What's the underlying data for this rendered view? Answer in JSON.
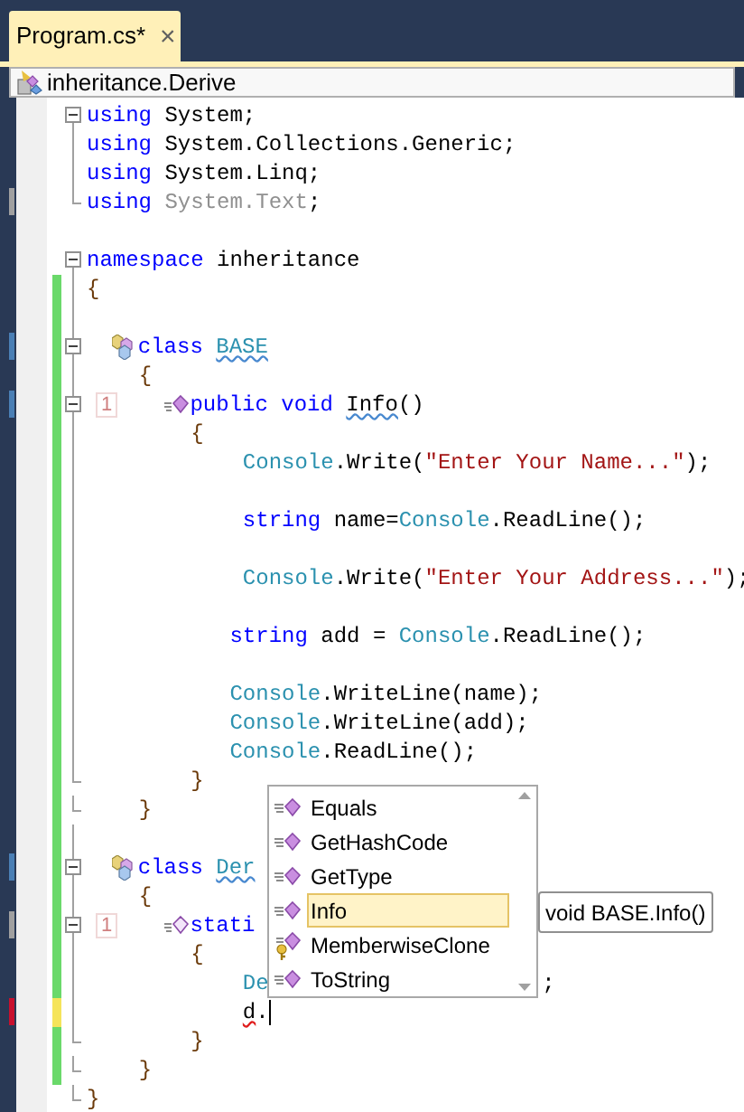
{
  "tab": {
    "title": "Program.cs*",
    "close": "×",
    "selected": true
  },
  "navigation": {
    "type": "inheritance.Derive"
  },
  "lines": [
    {
      "kind": "code",
      "expanded": true,
      "tokens": [
        {
          "kind": "keyword",
          "s": "using"
        },
        {
          "kind": "plain",
          "s": " System;"
        }
      ]
    },
    {
      "kind": "code",
      "tokens": [
        {
          "kind": "keyword",
          "s": "using"
        },
        {
          "kind": "plain",
          "s": " System.Collections.Generic;"
        }
      ]
    },
    {
      "kind": "code",
      "tokens": [
        {
          "kind": "keyword",
          "s": "using"
        },
        {
          "kind": "plain",
          "s": " System.Linq;"
        }
      ]
    },
    {
      "kind": "code",
      "region_end": true,
      "color": "#a0a0a0",
      "tokens": [
        {
          "kind": "keyword",
          "s": "using"
        },
        {
          "kind": "faded",
          "s": " System.Text"
        },
        {
          "kind": "plain",
          "s": ";"
        }
      ]
    },
    {
      "kind": "code"
    },
    {
      "kind": "code",
      "expanded": true,
      "tokens": [
        {
          "kind": "keyword",
          "s": "namespace"
        },
        {
          "kind": "plain",
          "s": " inheritance"
        }
      ]
    },
    {
      "kind": "code",
      "modified": true,
      "saved": true,
      "tokens": [
        {
          "kind": "brace",
          "s": "{"
        }
      ]
    },
    {
      "kind": "code",
      "modified": true,
      "saved": true
    },
    {
      "kind": "class",
      "expanded": true,
      "modified": true,
      "saved": true,
      "color": "#4a7fb5",
      "tokens": [
        {
          "kind": "keyword",
          "s": "  class"
        },
        {
          "kind": "type",
          "s": " BASE",
          "warning": true
        }
      ]
    },
    {
      "kind": "code",
      "modified": true,
      "saved": true,
      "tokens": [
        {
          "kind": "brace",
          "s": "    {"
        }
      ]
    },
    {
      "kind": "method",
      "expanded": true,
      "modified": true,
      "saved": true,
      "color": "#4a7fb5",
      "refs": "1",
      "tokens": [
        {
          "kind": "keyword",
          "s": "      public"
        },
        {
          "kind": "keyword",
          "s": " void"
        },
        {
          "kind": "plain",
          "s": " Info",
          "warning": true
        },
        {
          "kind": "plain",
          "s": "()"
        }
      ]
    },
    {
      "kind": "code",
      "modified": true,
      "saved": true,
      "tokens": [
        {
          "kind": "brace",
          "s": "        {"
        }
      ]
    },
    {
      "kind": "code",
      "modified": true,
      "saved": true,
      "tokens": [
        {
          "kind": "type",
          "s": "            Console"
        },
        {
          "kind": "plain",
          "s": ".Write("
        },
        {
          "kind": "string",
          "s": "\"Enter Your Name...\""
        },
        {
          "kind": "plain",
          "s": ");"
        }
      ]
    },
    {
      "kind": "code",
      "modified": true,
      "saved": true
    },
    {
      "kind": "code",
      "modified": true,
      "saved": true,
      "tokens": [
        {
          "kind": "keyword",
          "s": "            string"
        },
        {
          "kind": "plain",
          "s": " name="
        },
        {
          "kind": "type",
          "s": "Console"
        },
        {
          "kind": "plain",
          "s": ".ReadLine();"
        }
      ]
    },
    {
      "kind": "code",
      "modified": true,
      "saved": true
    },
    {
      "kind": "code",
      "modified": true,
      "saved": true,
      "tokens": [
        {
          "kind": "type",
          "s": "            Console"
        },
        {
          "kind": "plain",
          "s": ".Write("
        },
        {
          "kind": "string",
          "s": "\"Enter Your Address...\""
        },
        {
          "kind": "plain",
          "s": ");"
        }
      ]
    },
    {
      "kind": "code",
      "modified": true,
      "saved": true
    },
    {
      "kind": "code",
      "modified": true,
      "saved": true,
      "tokens": [
        {
          "kind": "keyword",
          "s": "           string"
        },
        {
          "kind": "plain",
          "s": " add = "
        },
        {
          "kind": "type",
          "s": "Console"
        },
        {
          "kind": "plain",
          "s": ".ReadLine();"
        }
      ]
    },
    {
      "kind": "code",
      "modified": true,
      "saved": true
    },
    {
      "kind": "code",
      "modified": true,
      "saved": true,
      "tokens": [
        {
          "kind": "type",
          "s": "           Console"
        },
        {
          "kind": "plain",
          "s": ".WriteLine(name);"
        }
      ]
    },
    {
      "kind": "code",
      "modified": true,
      "saved": true,
      "tokens": [
        {
          "kind": "type",
          "s": "           Console"
        },
        {
          "kind": "plain",
          "s": ".WriteLine(add);"
        }
      ]
    },
    {
      "kind": "code",
      "modified": true,
      "saved": true,
      "tokens": [
        {
          "kind": "type",
          "s": "           Console"
        },
        {
          "kind": "plain",
          "s": ".ReadLine();"
        }
      ]
    },
    {
      "kind": "code",
      "region_end": true,
      "modified": true,
      "saved": true,
      "tokens": [
        {
          "kind": "brace",
          "s": "        }"
        }
      ]
    },
    {
      "kind": "code",
      "region_end": true,
      "modified": true,
      "saved": true,
      "tokens": [
        {
          "kind": "brace",
          "s": "    }"
        }
      ]
    },
    {
      "kind": "code",
      "modified": true,
      "saved": true
    },
    {
      "kind": "class",
      "expanded": true,
      "modified": true,
      "saved": true,
      "color": "#4a7fb5",
      "tokens": [
        {
          "kind": "keyword",
          "s": "  class"
        },
        {
          "kind": "type",
          "s": " Der",
          "warning": true
        }
      ]
    },
    {
      "kind": "code",
      "modified": true,
      "saved": true,
      "tokens": [
        {
          "kind": "brace",
          "s": "    {"
        }
      ]
    },
    {
      "kind": "static",
      "expanded": true,
      "modified": true,
      "saved": true,
      "color": "#a0a0a0",
      "refs": "1",
      "tokens": [
        {
          "kind": "keyword",
          "s": "      stati"
        }
      ]
    },
    {
      "kind": "code",
      "modified": true,
      "saved": true,
      "tokens": [
        {
          "kind": "brace",
          "s": "        {"
        }
      ]
    },
    {
      "kind": "code",
      "modified": true,
      "saved": true,
      "tokens": [
        {
          "kind": "type",
          "s": "            De"
        },
        {
          "kind": "plain",
          "s": "                     ;"
        }
      ]
    },
    {
      "kind": "code",
      "modified": true,
      "saved": false,
      "color": "#c8102e",
      "caret": true,
      "tokens": [
        {
          "kind": "plain",
          "s": "            d",
          "error": true
        },
        {
          "kind": "plain",
          "s": "."
        }
      ]
    },
    {
      "kind": "code",
      "region_end": true,
      "modified": true,
      "saved": true,
      "tokens": [
        {
          "kind": "brace",
          "s": "        }"
        }
      ]
    },
    {
      "kind": "code",
      "region_end": true,
      "modified": true,
      "saved": true,
      "tokens": [
        {
          "kind": "brace",
          "s": "    }"
        }
      ]
    },
    {
      "kind": "code",
      "region_end": true,
      "tokens": [
        {
          "kind": "brace",
          "s": "}"
        }
      ]
    }
  ],
  "completion": {
    "items": [
      {
        "label": "Equals",
        "kind": "method",
        "selected": false
      },
      {
        "label": "GetHashCode",
        "kind": "method",
        "selected": false
      },
      {
        "label": "GetType",
        "kind": "method",
        "selected": false
      },
      {
        "label": "Info",
        "kind": "method",
        "selected": true
      },
      {
        "label": "MemberwiseClone",
        "kind": "protected",
        "selected": false
      },
      {
        "label": "ToString",
        "kind": "method",
        "selected": false
      }
    ],
    "tooltip": "void BASE.Info()"
  }
}
